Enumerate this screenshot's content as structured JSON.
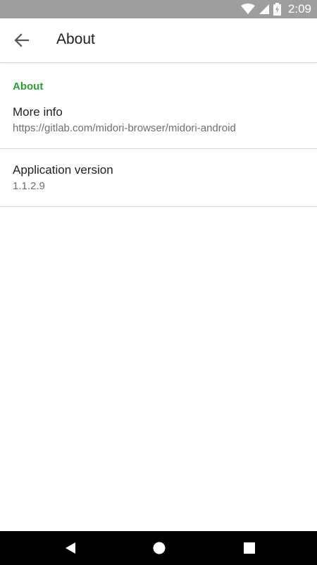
{
  "status_bar": {
    "time": "2:09",
    "icons": [
      "wifi-icon",
      "cellular-signal-icon",
      "battery-charging-icon"
    ]
  },
  "toolbar": {
    "back_icon": "arrow-left-icon",
    "title": "About"
  },
  "preferences": {
    "category": "About",
    "items": [
      {
        "title": "More info",
        "summary": "https://gitlab.com/midori-browser/midori-android"
      },
      {
        "title": "Application version",
        "summary": "1.1.2.9"
      }
    ]
  },
  "nav_bar": {
    "buttons": [
      "back-triangle-icon",
      "home-circle-icon",
      "recents-square-icon"
    ]
  },
  "colors": {
    "status_bar": "#9e9e9e",
    "accent": "#2aa134",
    "nav_bar": "#000000"
  }
}
